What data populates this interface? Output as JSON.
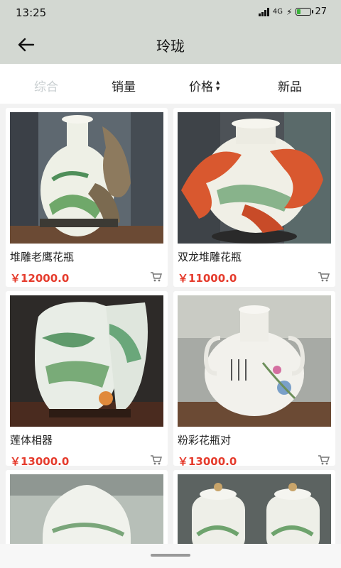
{
  "status_bar": {
    "time": "13:25",
    "network": "4G",
    "battery": "27",
    "battery_level": 0.27
  },
  "header": {
    "title": "玲珑"
  },
  "filter_tabs": [
    {
      "label": "综合",
      "active": true
    },
    {
      "label": "销量",
      "active": false
    },
    {
      "label": "价格",
      "active": false
    },
    {
      "label": "新品",
      "active": false
    }
  ],
  "products": [
    {
      "name": "堆雕老鹰花瓶",
      "price": "￥12000.0"
    },
    {
      "name": "双龙堆雕花瓶",
      "price": "￥11000.0"
    },
    {
      "name": "莲体相器",
      "price": "￥13000.0"
    },
    {
      "name": "粉彩花瓶对",
      "price": "￥13000.0"
    },
    {
      "name": "",
      "price": ""
    },
    {
      "name": "",
      "price": ""
    }
  ],
  "colors": {
    "header_bg": "#d3d8d2",
    "price": "#e53b2c",
    "active_tab": "#c9cfd1"
  }
}
